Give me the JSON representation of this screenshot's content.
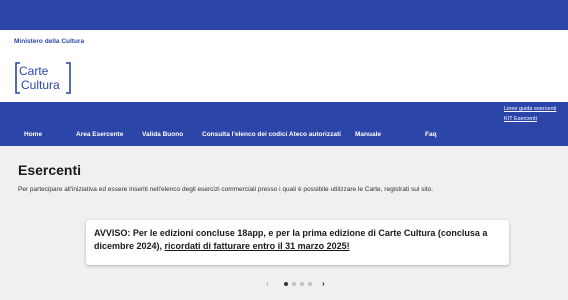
{
  "header": {
    "ministry": "Ministero della Cultura",
    "logo_text": [
      "Carte",
      "Cultura"
    ],
    "top_links": [
      "Linee guida esercenti",
      "KIT Esercenti"
    ]
  },
  "nav": {
    "items": [
      "Home",
      "Area Esercente",
      "Valida Buono",
      "Consulta l'elenco dei codici Ateco autorizzati",
      "Manuale",
      "Faq"
    ]
  },
  "main": {
    "title": "Esercenti",
    "intro": "Per partecipare all'iniziativa ed essere inseriti nell'elenco degli esercizi commerciali presso i quali è possibile utilizzare le Carte, registrati sul sito.",
    "notice_prefix": "AVVISO: Per le edizioni concluse 18app, e per la prima edizione di Carte Cultura (conclusa a dicembre 2024), ",
    "notice_link": "ricordati di fatturare entro il 31 marzo 2025!"
  },
  "carousel": {
    "prev": "‹",
    "next": "›",
    "total_slides": 4,
    "active_slide": 1
  },
  "colors": {
    "brand_blue": "#2b46a8",
    "page_bg": "#f0f0f0"
  }
}
